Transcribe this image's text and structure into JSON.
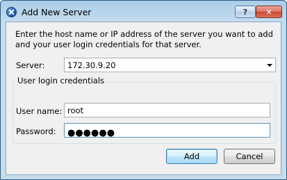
{
  "window": {
    "title": "Add New Server",
    "help_label": "?",
    "close_label": "✕"
  },
  "intro_text": "Enter the host name or IP address of the server you want to add and your user login credentials for that server.",
  "server": {
    "label": "Server:",
    "value": "172.30.9.20"
  },
  "credentials": {
    "legend": "User login credentials",
    "username_label": "User name:",
    "username_value": "root",
    "password_label": "Password:",
    "password_masked": "●●●●●●"
  },
  "buttons": {
    "add": "Add",
    "cancel": "Cancel"
  }
}
